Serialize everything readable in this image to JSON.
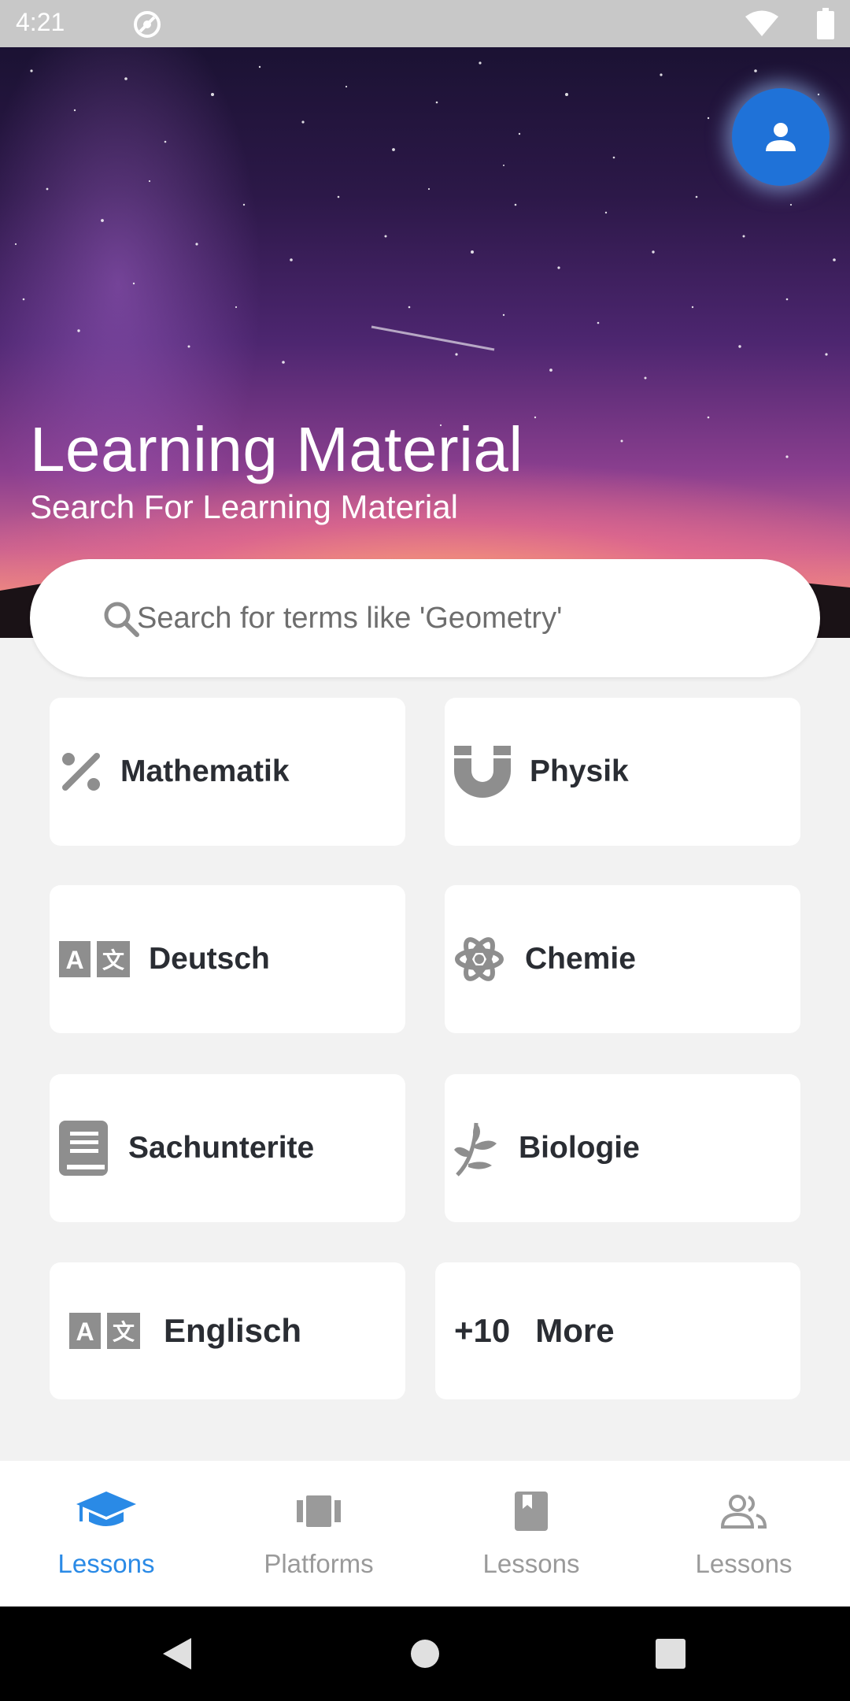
{
  "status_bar": {
    "time": "4:21",
    "icons": [
      "sync-icon",
      "wifi-icon",
      "battery-icon"
    ]
  },
  "header": {
    "title": "Learning Material",
    "subtitle": "Search For Learning Material",
    "profile_icon": "person-icon"
  },
  "search": {
    "placeholder": "Search for terms like 'Geometry'",
    "value": "",
    "icon": "search-icon"
  },
  "subjects": [
    {
      "label": "Mathematik",
      "icon": "percent-icon"
    },
    {
      "label": "Physik",
      "icon": "magnet-icon"
    },
    {
      "label": "Deutsch",
      "icon": "translate-icon"
    },
    {
      "label": "Chemie",
      "icon": "atom-icon"
    },
    {
      "label": "Sachunterite",
      "icon": "book-icon"
    },
    {
      "label": "Biologie",
      "icon": "plant-icon"
    },
    {
      "label": "Englisch",
      "icon": "translate-icon"
    }
  ],
  "more": {
    "count": "+10",
    "label": "More"
  },
  "bottom_nav": [
    {
      "label": "Lessons",
      "icon": "graduation-cap-icon",
      "active": true
    },
    {
      "label": "Platforms",
      "icon": "carousel-icon",
      "active": false
    },
    {
      "label": "Lessons",
      "icon": "bookmark-book-icon",
      "active": false
    },
    {
      "label": "Lessons",
      "icon": "people-icon",
      "active": false
    }
  ],
  "colors": {
    "accent": "#1f72d8",
    "nav_active": "#2a8ae6",
    "nav_inactive": "#9a9a9a",
    "icon_gray": "#8e8e8e",
    "card_text": "#2a2d33",
    "background": "#f2f2f2"
  }
}
